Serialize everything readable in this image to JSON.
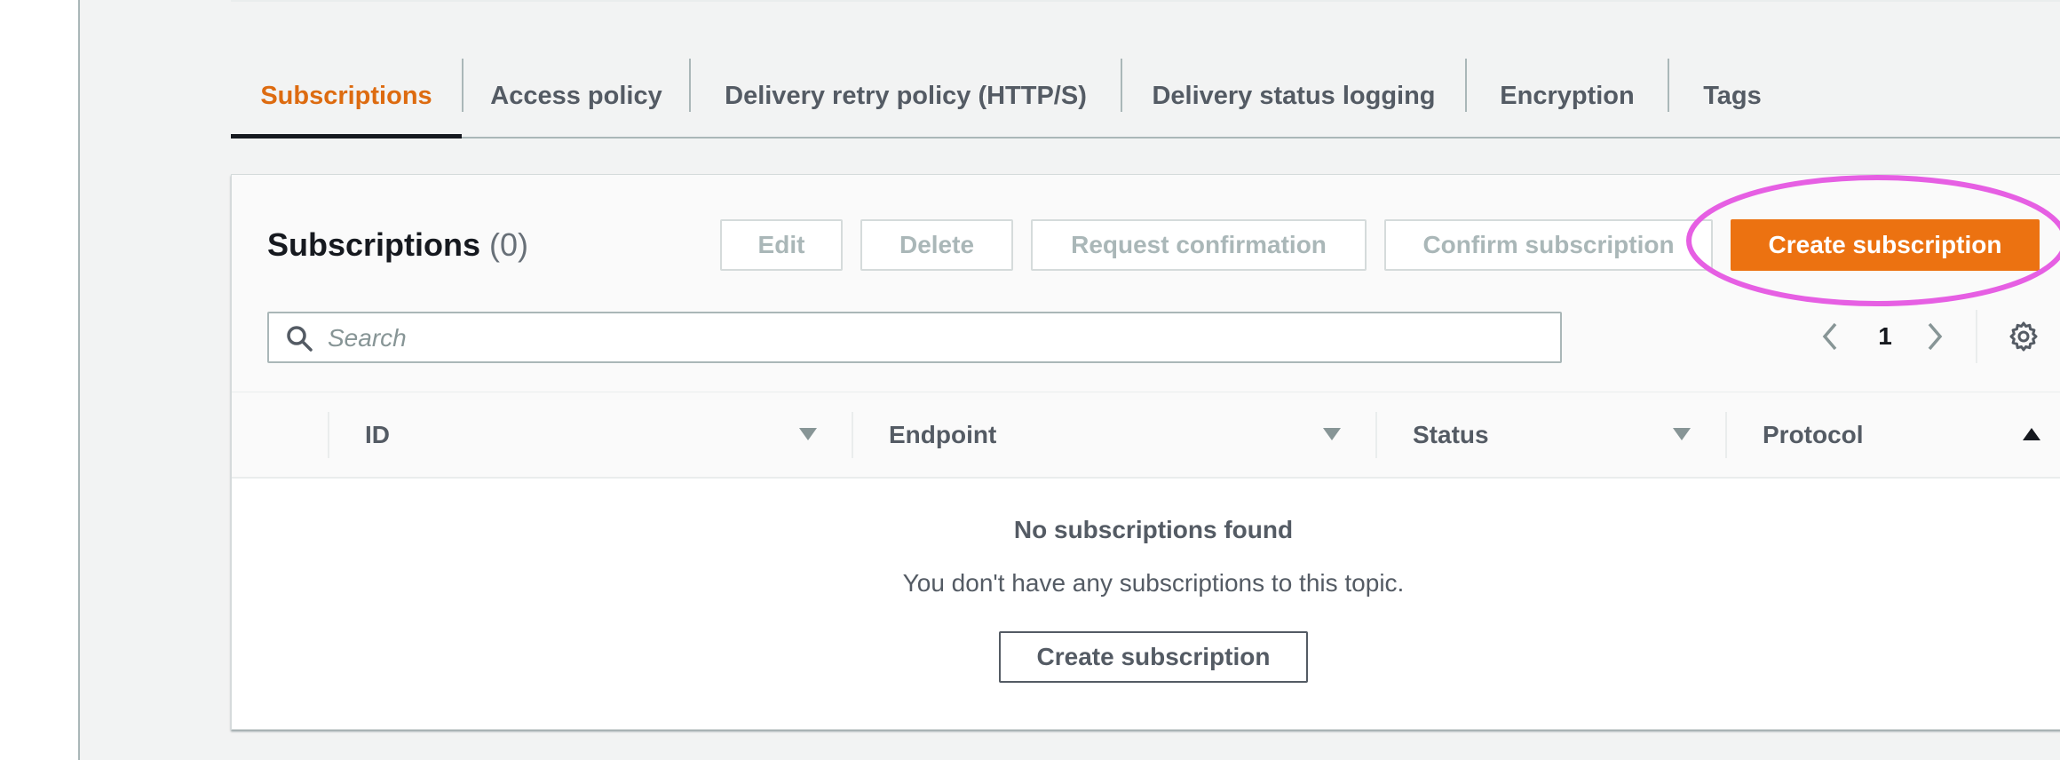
{
  "tabs": [
    {
      "label": "Subscriptions",
      "active": true
    },
    {
      "label": "Access policy",
      "active": false
    },
    {
      "label": "Delivery retry policy (HTTP/S)",
      "active": false
    },
    {
      "label": "Delivery status logging",
      "active": false
    },
    {
      "label": "Encryption",
      "active": false
    },
    {
      "label": "Tags",
      "active": false
    }
  ],
  "panel": {
    "title": "Subscriptions",
    "count": "(0)",
    "buttons": {
      "edit": "Edit",
      "delete": "Delete",
      "request_confirmation": "Request confirmation",
      "confirm_subscription": "Confirm subscription",
      "create_subscription": "Create subscription"
    },
    "search": {
      "placeholder": "Search",
      "value": ""
    },
    "pagination": {
      "current_page": "1"
    },
    "columns": [
      {
        "label": "ID",
        "sort": "desc"
      },
      {
        "label": "Endpoint",
        "sort": "desc"
      },
      {
        "label": "Status",
        "sort": "desc"
      },
      {
        "label": "Protocol",
        "sort": "asc"
      }
    ],
    "empty_state": {
      "title": "No subscriptions found",
      "description": "You don't have any subscriptions to this topic.",
      "button": "Create subscription"
    }
  },
  "colors": {
    "accent": "#ec7211",
    "active_tab": "#dd6b10",
    "highlight": "#e65fe3"
  },
  "icons": {
    "search": "search-icon",
    "prev": "chevron-left-icon",
    "next": "chevron-right-icon",
    "settings": "gear-icon",
    "sort_desc": "caret-down-icon",
    "sort_asc": "caret-up-icon"
  }
}
